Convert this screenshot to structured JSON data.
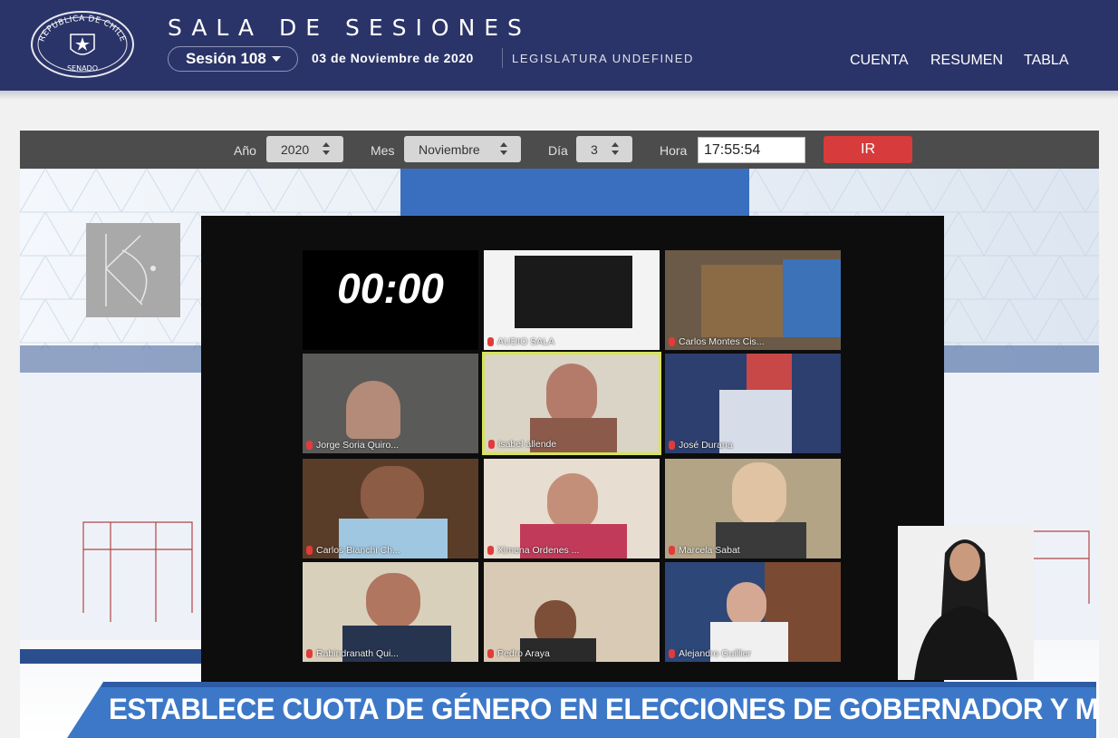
{
  "header": {
    "site_title": "SALA DE SESIONES",
    "seal_text_top": "REPUBLICA DE CHILE",
    "seal_text_bottom": "SENADO",
    "session_label": "Sesión 108",
    "session_date": "03 de Noviembre de 2020",
    "legislatura": "LEGISLATURA UNDEFINED",
    "nav": [
      "CUENTA",
      "RESUMEN",
      "TABLA"
    ]
  },
  "filters": {
    "year_label": "Año",
    "year_value": "2020",
    "month_label": "Mes",
    "month_value": "Noviembre",
    "day_label": "Día",
    "day_value": "3",
    "time_label": "Hora",
    "time_value": "17:55:54",
    "go_label": "IR"
  },
  "video": {
    "timer": "00:00",
    "participants": [
      "AUDIO SALA",
      "Carlos Montes Cis...",
      "Jorge Soria Quiro...",
      "isabel allende",
      "José Durana",
      "Carlos Bianchi Ch...",
      "Ximena Ordenes ...",
      "Marcela Sabat",
      "Rabindranath Qui...",
      "Pedro Araya",
      "Alejandro Guillier"
    ],
    "banner": "ESTABLECE CUOTA DE GÉNERO EN ELECCIONES DE GOBERNADOR Y MUNICIPALES",
    "colors": {
      "header_bg": "#2b3468",
      "go_button": "#d73b3b",
      "banner_blue": "#3d78c8",
      "active_speaker_border": "#d7e35a"
    }
  }
}
